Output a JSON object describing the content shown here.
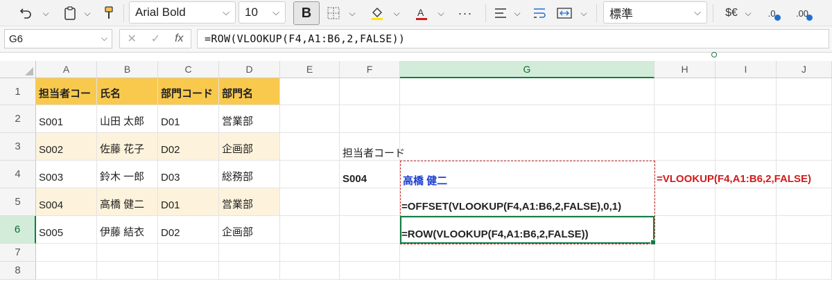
{
  "toolbar": {
    "font_name": "Arial Bold",
    "font_size": "10",
    "bold_label": "B",
    "more": "···",
    "number_format": "標準",
    "currency": "$€",
    "inc_decimal": ".0",
    "dec_decimal": ".00"
  },
  "formula_bar": {
    "name_box": "G6",
    "fx": "fx",
    "formula": "=ROW(VLOOKUP(F4,A1:B6,2,FALSE))"
  },
  "columns": [
    "A",
    "B",
    "C",
    "D",
    "E",
    "F",
    "G",
    "H",
    "I",
    "J"
  ],
  "selected_column": "G",
  "rows": [
    "1",
    "2",
    "3",
    "4",
    "5",
    "6",
    "7",
    "8"
  ],
  "selected_row": "6",
  "table": {
    "headers": [
      "担当者コー",
      "氏名",
      "部門コード",
      "部門名"
    ],
    "data": [
      [
        "S001",
        "山田 太郎",
        "D01",
        "営業部"
      ],
      [
        "S002",
        "佐藤 花子",
        "D02",
        "企画部"
      ],
      [
        "S003",
        "鈴木 一郎",
        "D03",
        "総務部"
      ],
      [
        "S004",
        "高橋 健二",
        "D01",
        "営業部"
      ],
      [
        "S005",
        "伊藤 結衣",
        "D02",
        "企画部"
      ]
    ]
  },
  "lookup": {
    "label": "担当者コード",
    "code": "S004",
    "result": "高橋 健二",
    "vlookup_formula": "=VLOOKUP(F4,A1:B6,2,FALSE)",
    "offset_formula": "=OFFSET(VLOOKUP(F4,A1:B6,2,FALSE),0,1)",
    "row_formula": "=ROW(VLOOKUP(F4,A1:B6,2,FALSE))"
  },
  "colors": {
    "header_fill": "#f9c94e",
    "band_fill": "#fdf3dc",
    "selection": "#107c41",
    "result_blue": "#1f3fd1",
    "formula_red": "#d11a1a"
  }
}
